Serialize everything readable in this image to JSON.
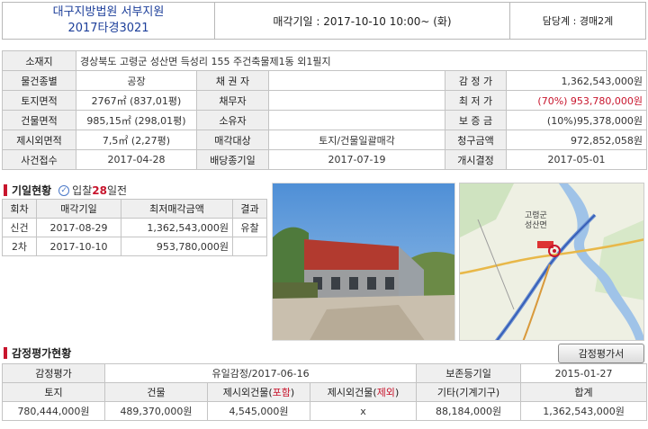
{
  "header": {
    "court_line1": "대구지방법원 서부지원",
    "court_line2": "2017타경3021",
    "sale_date": "매각기일 : 2017-10-10   10:00~ (화)",
    "dept": "담당계 : 경매2계"
  },
  "info": {
    "address_label": "소재지",
    "address_value": "경상북도 고령군 성산면 득성리 155 주건축물제1동 외1필지",
    "type_label": "물건종별",
    "type_value": "공장",
    "creditor_label": "채 권 자",
    "creditor_value": "",
    "appraisal_label": "감 정 가",
    "appraisal_value": "1,362,543,000원",
    "land_label": "토지면적",
    "land_value": "2767㎡ (837,01평)",
    "debtor_label": "채무자",
    "debtor_value": "",
    "min_label": "최 저 가",
    "min_value": "(70%) 953,780,000원",
    "bldg_label": "건물면적",
    "bldg_value": "985,15㎡ (298,01평)",
    "owner_label": "소유자",
    "owner_value": "",
    "deposit_label": "보 증 금",
    "deposit_value": "(10%)95,378,000원",
    "excl_label": "제시외면적",
    "excl_value": "7,5㎡ (2,27평)",
    "target_label": "매각대상",
    "target_value": "토지/건물일괄매각",
    "claim_label": "청구금액",
    "claim_value": "972,852,058원",
    "receipt_label": "사건접수",
    "receipt_value": "2017-04-28",
    "dividend_label": "배당종기일",
    "dividend_value": "2017-07-19",
    "start_label": "개시결정",
    "start_value": "2017-05-01"
  },
  "history": {
    "title": "기일현황",
    "badge_prefix": "입찰",
    "badge_num": "28",
    "badge_suffix": "일전",
    "headers": [
      "회차",
      "매각기일",
      "최저매각금액",
      "결과"
    ],
    "rows": [
      [
        "신건",
        "2017-08-29",
        "1,362,543,000원",
        "유찰"
      ],
      [
        "2차",
        "2017-10-10",
        "953,780,000원",
        ""
      ]
    ]
  },
  "map": {
    "place": "고령군",
    "place2": "성산면"
  },
  "appraisal": {
    "title": "감정평가현황",
    "button": "감정평가서",
    "row1_label": "감정평가",
    "row1_value": "유일감정/2017-06-16",
    "row1_label2": "보존등기일",
    "row1_value2": "2015-01-27",
    "h_land": "토지",
    "h_bldg": "건물",
    "h_incl_prefix": "제시외건물(",
    "h_incl_mark": "포함",
    "h_excl_prefix": "제시외건물(",
    "h_excl_mark": "제외",
    "h_close": ")",
    "h_other": "기타(기계기구)",
    "h_total": "합계",
    "v_land": "780,444,000원",
    "v_bldg": "489,370,000원",
    "v_incl": "4,545,000원",
    "v_excl": "x",
    "v_other": "88,184,000원",
    "v_total": "1,362,543,000원"
  },
  "colors": {
    "accent": "#c8152d",
    "court_blue": "#1d3f9a",
    "label_bg": "#efefef"
  }
}
